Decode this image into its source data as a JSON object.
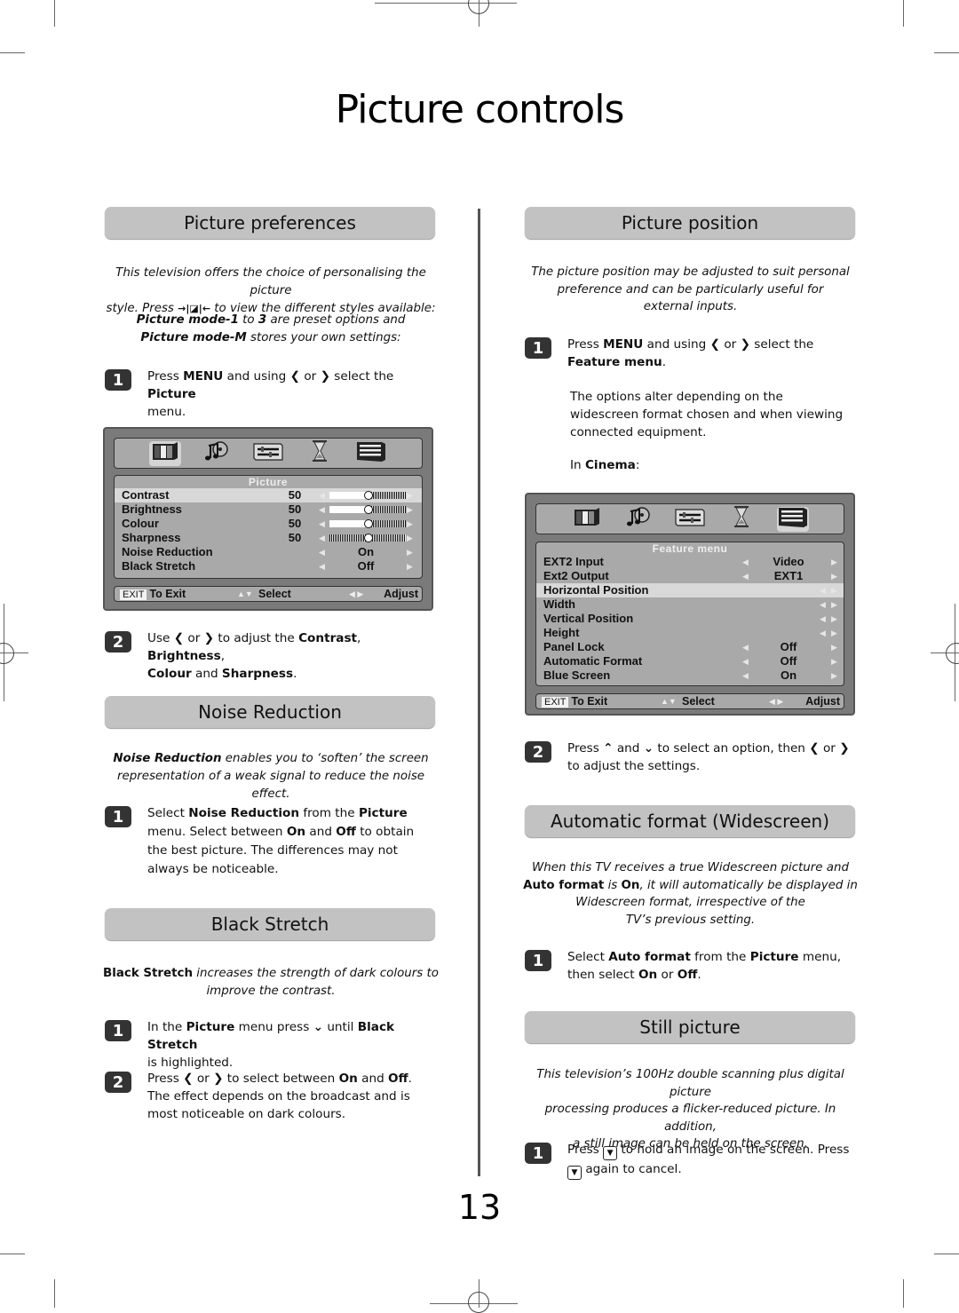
{
  "page": {
    "title": "Picture controls",
    "page_number": "13"
  },
  "picture_preferences": {
    "heading": "Picture preferences",
    "intro_line1": "This television offers the choice of personalising the picture",
    "intro_line2_pre": "style. Press ",
    "intro_line2_icon": "→|◪|←",
    "intro_line2_post": " to view the different styles available:",
    "modes_bold1": "Picture mode-1",
    "modes_mid1": " to ",
    "modes_bold2": "3",
    "modes_mid2": " are preset options and",
    "modes_bold3": "Picture mode-M",
    "modes_end": " stores your own settings:",
    "step1": {
      "num": "1",
      "t1": "Press ",
      "b1": "MENU",
      "t2": " and using ",
      "i1": "❮",
      "t3": " or ",
      "i2": "❯",
      "t4": " select the ",
      "b2": "Picture",
      "t5": " menu."
    },
    "step2": {
      "num": "2",
      "t1": "Use ",
      "i1": "❮",
      "t2": " or ",
      "i2": "❯",
      "t3": " to adjust the ",
      "b1": "Contrast",
      "t4": ", ",
      "b2": "Brightness",
      "t5": ", ",
      "b3": "Colour",
      "t6": " and ",
      "b4": "Sharpness",
      "t7": "."
    }
  },
  "picture_menu": {
    "title": "Picture",
    "tabs": [
      "picture",
      "sound",
      "settings",
      "timer",
      "feature"
    ],
    "selected_tab": 0,
    "rows": [
      {
        "label": "Contrast",
        "value": "50",
        "level": 0.5,
        "slider": "single"
      },
      {
        "label": "Brightness",
        "value": "50",
        "level": 0.5,
        "slider": "single"
      },
      {
        "label": "Colour",
        "value": "50",
        "level": 0.5,
        "slider": "single"
      },
      {
        "label": "Sharpness",
        "value": "50",
        "level": 0.5,
        "slider": "center"
      },
      {
        "label": "Noise Reduction",
        "option": "On"
      },
      {
        "label": "Black Stretch",
        "option": "Off"
      }
    ],
    "highlighted_row": 0,
    "footer": {
      "exit_key": "EXIT",
      "exit_label": "To Exit",
      "select_icon": "▲▼",
      "select_label": "Select",
      "adjust_icon": "◀ ▶",
      "adjust_label": "Adjust"
    }
  },
  "noise_reduction": {
    "heading": "Noise Reduction",
    "intro_bold": "Noise Reduction",
    "intro_rest1": " enables you to ‘soften’ the screen",
    "intro_line2": "representation of a weak signal to reduce the noise effect.",
    "step1": {
      "num": "1",
      "t1": "Select ",
      "b1": "Noise Reduction",
      "t2": " from the ",
      "b2": "Picture",
      "t3": " menu. Select between ",
      "b3": "On",
      "t4": " and ",
      "b4": "Off",
      "t5": " to obtain the best picture. The differences may not always be noticeable."
    }
  },
  "black_stretch": {
    "heading": "Black Stretch",
    "intro_bold": "Black Stretch",
    "intro_rest1": " increases the strength of dark colours to",
    "intro_line2": "improve the contrast.",
    "step1": {
      "num": "1",
      "t1": "In the ",
      "b1": "Picture",
      "t2": " menu press ",
      "i1": "⌄",
      "t3": " until ",
      "b2": "Black Stretch",
      "t4": " is highlighted."
    },
    "step2": {
      "num": "2",
      "t1": "Press ",
      "i1": "❮",
      "t2": " or ",
      "i2": "❯",
      "t3": " to select between ",
      "b1": "On",
      "t4": " and ",
      "b2": "Off",
      "t5": ". The effect depends on the broadcast and is most noticeable on dark colours."
    }
  },
  "picture_position": {
    "heading": "Picture position",
    "intro_line1": "The picture position may be adjusted to suit personal",
    "intro_line2": "preference and can be particularly useful for",
    "intro_line3": "external inputs.",
    "step1": {
      "num": "1",
      "t1": "Press ",
      "b1": "MENU",
      "t2": " and using ",
      "i1": "❮",
      "t3": " or ",
      "i2": "❯",
      "t4": " select the ",
      "b2": "Feature menu",
      "t5": "."
    },
    "note": "The options alter depending on the widescreen format chosen and when viewing connected equipment.",
    "in_label": "In ",
    "in_bold": "Cinema",
    "in_end": ":",
    "step2": {
      "num": "2",
      "t1": "Press ",
      "i1": "⌃",
      "t2": " and ",
      "i2": "⌄",
      "t3": " to select an option, then ",
      "i3": "❮",
      "t4": " or ",
      "i4": "❯",
      "t5": " to adjust the settings."
    }
  },
  "feature_menu": {
    "title": "Feature menu",
    "tabs": [
      "picture",
      "sound",
      "settings",
      "timer",
      "feature"
    ],
    "selected_tab": 4,
    "rows": [
      {
        "label": "EXT2 Input",
        "option": "Video"
      },
      {
        "label": "Ext2 Output",
        "option": "EXT1"
      },
      {
        "label": "Horizontal Position",
        "arrows_only": true
      },
      {
        "label": "Width",
        "arrows_only": true
      },
      {
        "label": "Vertical Position",
        "arrows_only": true
      },
      {
        "label": "Height",
        "arrows_only": true
      },
      {
        "label": "Panel Lock",
        "option": "Off"
      },
      {
        "label": "Automatic Format",
        "option": "Off"
      },
      {
        "label": "Blue Screen",
        "option": "On"
      }
    ],
    "highlighted_row": 2,
    "footer": {
      "exit_key": "EXIT",
      "exit_label": "To Exit",
      "select_icon": "▲▼",
      "select_label": "Select",
      "adjust_icon": "◀ ▶",
      "adjust_label": "Adjust"
    }
  },
  "automatic_format": {
    "heading": "Automatic format (Widescreen)",
    "intro_line1": "When this TV receives a true Widescreen picture and",
    "intro_b1": "Auto format",
    "intro_m1": " is ",
    "intro_b2": "On",
    "intro_m2": ", it will automatically be displayed in",
    "intro_line3": "Widescreen format, irrespective of the",
    "intro_line4": "TV’s previous setting.",
    "step1": {
      "num": "1",
      "t1": "Select ",
      "b1": "Auto format",
      "t2": " from the ",
      "b2": "Picture",
      "t3": " menu, then select ",
      "b3": "On",
      "t4": " or ",
      "b4": "Off",
      "t5": "."
    }
  },
  "still_picture": {
    "heading": "Still picture",
    "intro_line1": "This television’s 100Hz double scanning plus digital picture",
    "intro_line2": "processing produces a flicker-reduced picture. In addition,",
    "intro_line3": "a still image can be held on the screen.",
    "step1": {
      "num": "1",
      "t1": "Press ",
      "i1": "▼",
      "t2": " to hold an image on the screen. Press ",
      "i2": "▼",
      "t3": " again to cancel."
    }
  }
}
